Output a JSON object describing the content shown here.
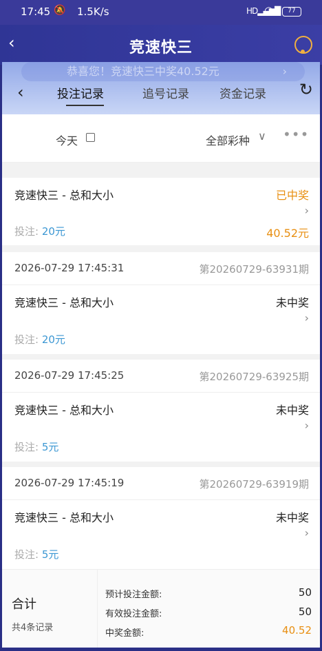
{
  "status_bar": {
    "time": "17:45",
    "speed": "1.5K/s",
    "battery": "77",
    "signal": "HD"
  },
  "app_bar": {
    "title": "竞速快三"
  },
  "banner": {
    "text": "恭喜您！竞速快三中奖40.52元"
  },
  "tabs": [
    {
      "label": "投注记录",
      "active": true
    },
    {
      "label": "追号记录",
      "active": false
    },
    {
      "label": "资金记录",
      "active": false
    }
  ],
  "filter": {
    "date": "今天",
    "lottery": "全部彩种"
  },
  "records": [
    {
      "date": "",
      "issue": "",
      "name": "竞速快三 - 总和大小",
      "status": "已中奖",
      "stake_label": "投注:",
      "stake": "20元",
      "prize": "40.52元"
    },
    {
      "date": "2026-07-29 17:45:31",
      "issue": "第20260729-63931期",
      "name": "竞速快三 - 总和大小",
      "status": "未中奖",
      "stake_label": "投注:",
      "stake": "20元",
      "prize": ""
    },
    {
      "date": "2026-07-29 17:45:25",
      "issue": "第20260729-63925期",
      "name": "竞速快三 - 总和大小",
      "status": "未中奖",
      "stake_label": "投注:",
      "stake": "5元",
      "prize": ""
    },
    {
      "date": "2026-07-29 17:45:19",
      "issue": "第20260729-63919期",
      "name": "竞速快三 - 总和大小",
      "status": "未中奖",
      "stake_label": "投注:",
      "stake": "5元",
      "prize": ""
    }
  ],
  "summary": {
    "title": "合计",
    "count": "共4条记录",
    "estimated_label": "预计投注金额:",
    "estimated_value": "50",
    "valid_label": "有效投注金额:",
    "valid_value": "50",
    "prize_label": "中奖金额:",
    "prize_value": "40.52"
  },
  "colors": {
    "accent": "#e88f12",
    "stake": "#3b97d3",
    "header": "#2f3595"
  }
}
